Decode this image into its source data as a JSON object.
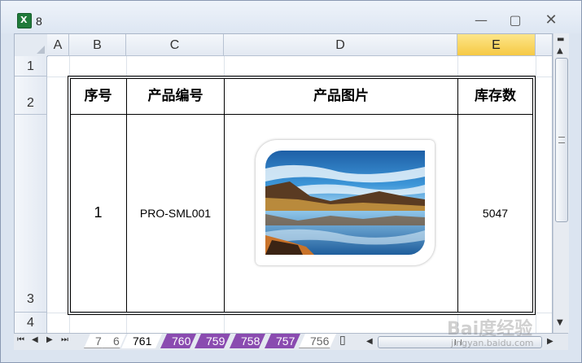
{
  "window": {
    "title": "8",
    "min_glyph": "—",
    "max_glyph": "▢",
    "close_glyph": "✕"
  },
  "columns": [
    "A",
    "B",
    "C",
    "D",
    "E"
  ],
  "selected_column": "E",
  "rows": [
    "1",
    "2",
    "3",
    "4"
  ],
  "table": {
    "headers": [
      "序号",
      "产品编号",
      "产品图片",
      "库存数"
    ],
    "row": {
      "index": "1",
      "product_code": "PRO-SML001",
      "image_alt": "landscape lake photo",
      "stock": "5047"
    }
  },
  "sheet_tabs": [
    {
      "label": "7",
      "style": "gray"
    },
    {
      "label": "6",
      "style": "gray"
    },
    {
      "label": "761",
      "style": "active"
    },
    {
      "label": "760",
      "style": "purple"
    },
    {
      "label": "759",
      "style": "purple"
    },
    {
      "label": "758",
      "style": "purple"
    },
    {
      "label": "757",
      "style": "purple"
    },
    {
      "label": "756",
      "style": "gray"
    }
  ],
  "nav_buttons": [
    "⏮",
    "◀",
    "▶",
    "⏭"
  ],
  "watermark": {
    "logo": "Bai度经验",
    "url": "jingyan.baidu.com"
  },
  "colors": {
    "selected_header": "#f6c944",
    "tab_purple": "#8a4bb0",
    "excel_green": "#1f7a3a"
  }
}
